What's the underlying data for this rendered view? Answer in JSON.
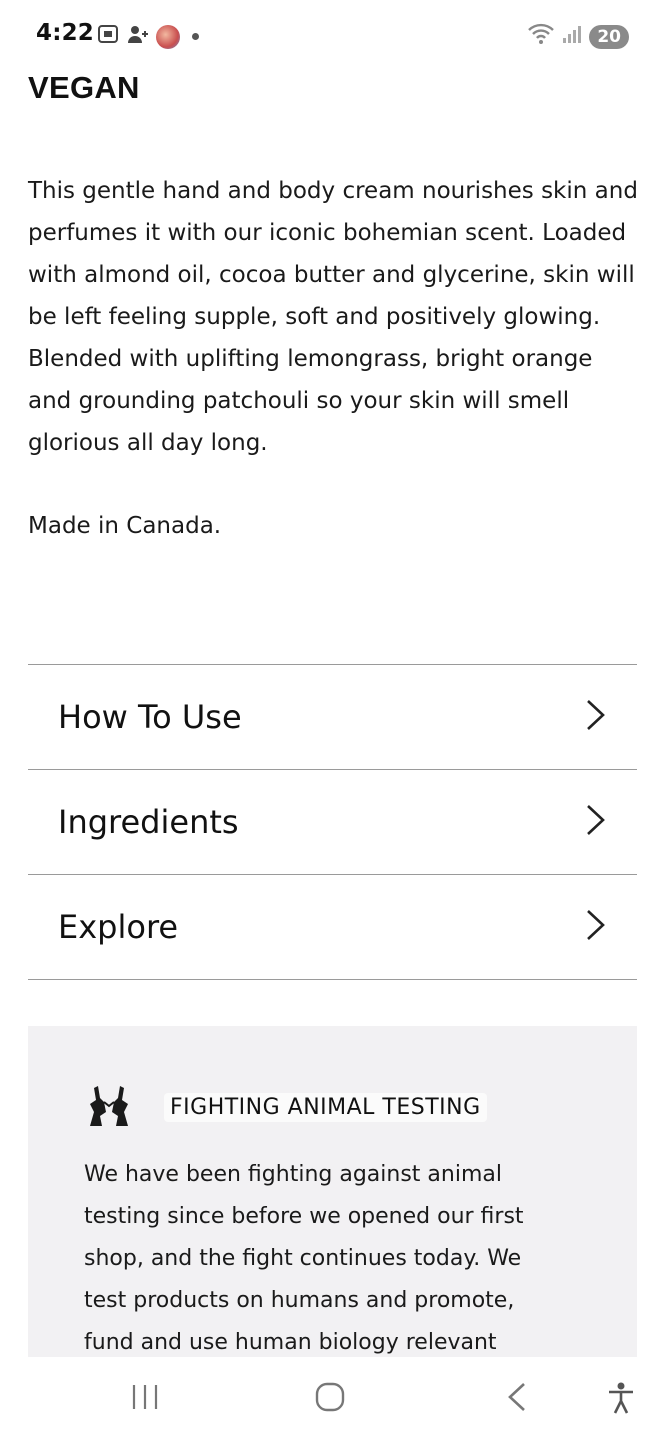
{
  "status_bar": {
    "time": "4:22",
    "battery": "20",
    "icons": [
      "screenshot-icon",
      "person-add-icon",
      "avatar",
      "notification-dot",
      "wifi-icon",
      "signal-icon",
      "battery-icon"
    ]
  },
  "product": {
    "heading": "VEGAN",
    "description": "This gentle hand and body cream nourishes skin and perfumes it with our iconic bohemian scent. Loaded with almond oil, cocoa butter and glycerine, skin will be left feeling supple, soft and positively glowing. Blended with uplifting lemongrass, bright orange and grounding patchouli so your skin will smell glorious all day long.",
    "origin": "Made in Canada."
  },
  "accordion": {
    "items": [
      {
        "label": "How To Use"
      },
      {
        "label": "Ingredients"
      },
      {
        "label": "Explore"
      }
    ]
  },
  "promo": {
    "title": "FIGHTING ANIMAL TESTING",
    "text": "We have been fighting against animal testing since before we opened our first shop, and the fight continues today. We test products on humans and promote, fund and use human biology relevant",
    "icon": "rabbits-icon",
    "background": "#f2f1f3"
  },
  "nav_bar": {
    "items": [
      "recent-apps-icon",
      "home-icon",
      "back-icon",
      "accessibility-icon"
    ]
  }
}
